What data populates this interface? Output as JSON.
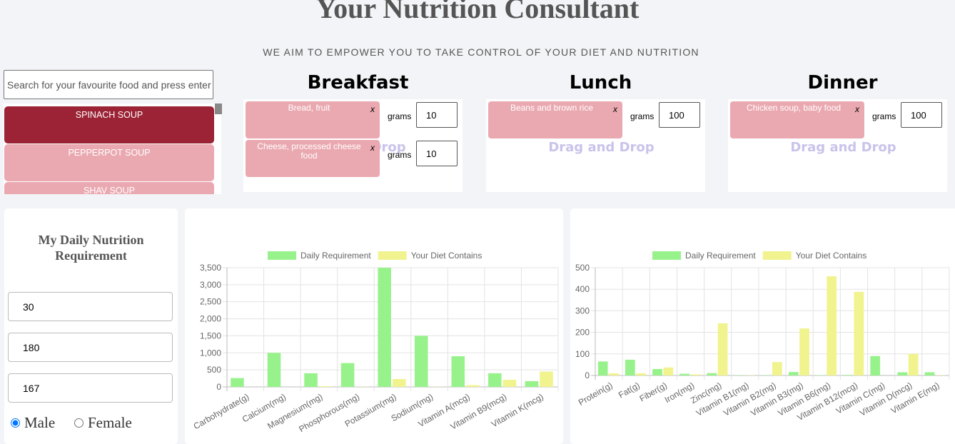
{
  "header": {
    "title": "Your Nutrition Consultant",
    "subtitle": "WE AIM TO EMPOWER YOU TO TAKE CONTROL OF YOUR DIET AND NUTRITION"
  },
  "search": {
    "placeholder": "Search for your favourite food and press enter",
    "value": ""
  },
  "food_list": [
    {
      "label": "SPINACH SOUP",
      "selected": true
    },
    {
      "label": "PEPPERPOT SOUP",
      "selected": false
    },
    {
      "label": "SHAV SOUP",
      "selected": false
    }
  ],
  "meals": {
    "drop_hint": "Drag and Drop",
    "grams_label": "grams",
    "remove": "x",
    "breakfast": {
      "title": "Breakfast",
      "items": [
        {
          "name": "Bread, fruit",
          "grams": "10"
        },
        {
          "name": "Cheese, processed cheese food",
          "grams": "10"
        }
      ]
    },
    "lunch": {
      "title": "Lunch",
      "items": [
        {
          "name": "Beans and brown rice",
          "grams": "100"
        }
      ]
    },
    "dinner": {
      "title": "Dinner",
      "items": [
        {
          "name": "Chicken soup, baby food",
          "grams": "100"
        }
      ]
    }
  },
  "requirement": {
    "title": "My Daily Nutrition Requirement",
    "age": "30",
    "height": "180",
    "weight": "167",
    "gender_options": [
      "Male",
      "Female"
    ],
    "gender_selected": "Male"
  },
  "colors": {
    "daily": "#98f28c",
    "diet": "#f1f38e",
    "selected_food": "#9b2335",
    "food": "#eaa9b1"
  },
  "chart_data": [
    {
      "type": "bar",
      "legend": [
        "Daily Requirement",
        "Your Diet Contains"
      ],
      "legend_position": "top",
      "ylim": [
        0,
        3500
      ],
      "yticks": [
        0,
        500,
        1000,
        1500,
        2000,
        2500,
        3000,
        3500
      ],
      "categories": [
        "Carbohydrate(g)",
        "Calcium(mg)",
        "Magnesium(mg)",
        "Phosphorous(mg)",
        "Potassium(mg)",
        "Sodium(mg)",
        "Vitamin A(mcg)",
        "Vitamin B9(mcg)",
        "Vitamin K(mcg)"
      ],
      "series": [
        {
          "name": "Daily Requirement",
          "values": [
            260,
            1000,
            400,
            700,
            3500,
            1500,
            900,
            400,
            170
          ]
        },
        {
          "name": "Your Diet Contains",
          "values": [
            0,
            0,
            20,
            5,
            230,
            5,
            50,
            210,
            450
          ]
        }
      ]
    },
    {
      "type": "bar",
      "legend": [
        "Daily Requirement",
        "Your Diet Contains"
      ],
      "legend_position": "top",
      "ylim": [
        0,
        500
      ],
      "yticks": [
        0,
        100,
        200,
        300,
        400,
        500
      ],
      "categories": [
        "Protein(g)",
        "Fat(g)",
        "Fiber(g)",
        "Iron(mg)",
        "Zinc(mg)",
        "Vitamin B1(mg)",
        "Vitamin B2(mg)",
        "Vitamin B3(mg)",
        "Vitamin B6(mg)",
        "Vitamin B12(mcg)",
        "Vitamin C(mg)",
        "Vitamin D(mcg)",
        "Vitamin E(mg)"
      ],
      "series": [
        {
          "name": "Daily Requirement",
          "values": [
            65,
            73,
            30,
            8,
            11,
            1.2,
            1.3,
            16,
            1.3,
            2.4,
            90,
            15,
            15
          ]
        },
        {
          "name": "Your Diet Contains",
          "values": [
            10,
            10,
            37,
            5,
            242,
            1,
            62,
            218,
            460,
            388,
            0,
            100,
            1
          ]
        }
      ]
    }
  ]
}
